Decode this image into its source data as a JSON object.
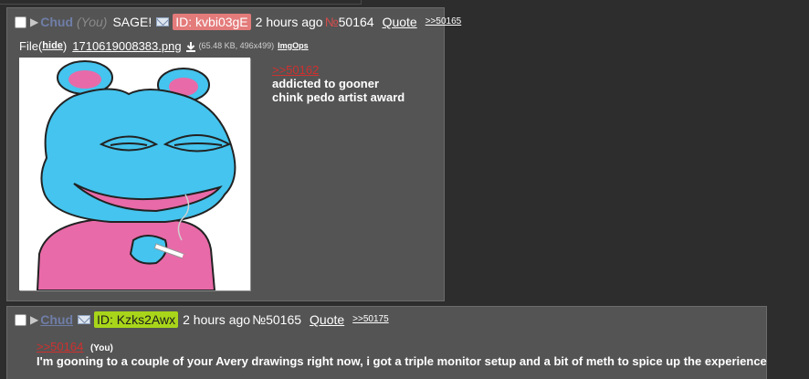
{
  "post1": {
    "name": "Chud",
    "you_marker": "(You)",
    "subject": "SAGE!",
    "id": "ID: kvbi03gE",
    "time": "2 hours ago",
    "number_prefix": "№",
    "number": "50164",
    "quote_label": "Quote",
    "backlink": ">>50165",
    "file": {
      "label": "File",
      "paren_open": "(",
      "paren_close": ")",
      "hide_label": "hide",
      "filename": "1710619008383.png",
      "meta": "(65.48 KB, 496x499)",
      "imgops_label": "ImgOps"
    },
    "body": {
      "quote_ref": ">>50162",
      "lines": [
        "addicted to gooner",
        "chink pedo artist award"
      ]
    }
  },
  "post2": {
    "name": "Chud",
    "id": "ID: Kzks2Awx",
    "time": "2 hours ago",
    "number_prefix": "№",
    "number": "50165",
    "quote_label": "Quote",
    "backlink": ">>50175",
    "body": {
      "quote_ref": ">>50164",
      "you_marker": "(You)",
      "line": "I'm gooning to a couple of your Avery drawings right now, i got a triple monitor setup and a bit of meth to spice up the experience"
    }
  },
  "icons": {
    "checkbox": "checkbox-icon",
    "expand": "triangle-right-icon",
    "email": "envelope-icon",
    "download": "download-icon"
  },
  "colors": {
    "background": "#2d2d2d",
    "post_bg": "#545454",
    "name": "#6f7ea8",
    "id_badge_1": "#e47b7b",
    "id_badge_2": "#a8d51a",
    "quote_ref": "#d0302f"
  }
}
